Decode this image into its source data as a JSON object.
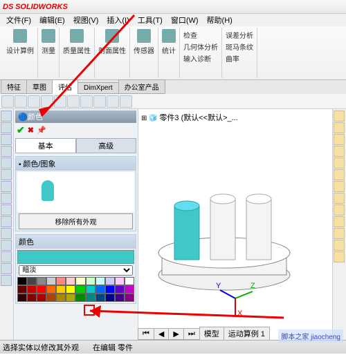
{
  "app": {
    "name": "SOLIDWORKS"
  },
  "menu": {
    "file": "文件(F)",
    "edit": "编辑(E)",
    "view": "视图(V)",
    "insert": "插入(I)",
    "tools": "工具(T)",
    "window": "窗口(W)",
    "help": "帮助(H)"
  },
  "ribbon": {
    "design_study": "设计算例",
    "measure": "测量",
    "mass_props": "质量属性",
    "section_props": "剖面属性",
    "sensor": "传感器",
    "statistics": "统计",
    "check": "检查",
    "geom_analysis": "几何体分析",
    "import_diag": "输入诊断",
    "deviation": "误差分析",
    "zebra": "斑马条纹",
    "curvature": "曲率"
  },
  "tabs": {
    "features": "特征",
    "sketch": "草图",
    "evaluate": "评估",
    "dimxpert": "DimXpert",
    "office": "办公室产品"
  },
  "panel": {
    "title": "颜色",
    "basic": "基本",
    "advanced": "高级",
    "color_image": "颜色/图象",
    "remove_all": "移除所有外观",
    "color_section": "颜色",
    "shade": "暗淡"
  },
  "tree": {
    "node": "零件3 (默认<<默认>_..."
  },
  "bottom": {
    "model": "模型",
    "motion": "运动算例 1"
  },
  "status": {
    "hint": "选择实体以修改其外观",
    "mode": "在编辑 零件"
  },
  "watermark": "脚本之家 jiaocheng",
  "colors": {
    "selected": "#40c8c8"
  },
  "palette": [
    "#000",
    "#444",
    "#888",
    "#ccc",
    "#f88",
    "#fcc",
    "#ffc",
    "#cfc",
    "#cff",
    "#ccf",
    "#fcf",
    "#fff",
    "#600",
    "#c00",
    "#f00",
    "#f60",
    "#fc0",
    "#ff0",
    "#0c0",
    "#0cc",
    "#06f",
    "#00f",
    "#60c",
    "#c0c",
    "#300",
    "#800",
    "#a00",
    "#a40",
    "#a80",
    "#aa0",
    "#080",
    "#088",
    "#048",
    "#008",
    "#408",
    "#808"
  ]
}
